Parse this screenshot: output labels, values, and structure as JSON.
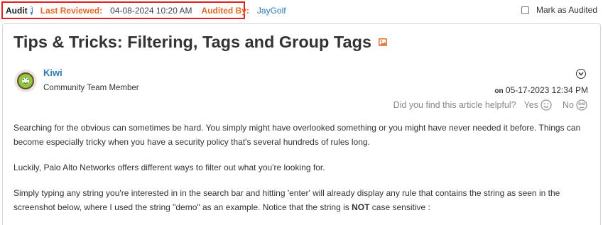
{
  "audit": {
    "label": "Audit",
    "last_reviewed_label": "Last Reviewed:",
    "last_reviewed_value": "04-08-2024 10:20 AM",
    "audited_by_label": "Audited By:",
    "audited_by_value": "JayGolf",
    "mark_label": "Mark as Audited",
    "info_icon_text": "i"
  },
  "article": {
    "title": "Tips & Tricks: Filtering, Tags and Group Tags",
    "author": {
      "name": "Kiwi",
      "role": "Community Team Member"
    },
    "date_prefix": "on",
    "date": "05-17-2023 12:34 PM",
    "helpful": {
      "question": "Did you find this article helpful?",
      "yes_label": "Yes",
      "no_label": "No"
    },
    "paragraphs": {
      "p1": "Searching for the obvious can sometimes be hard. You simply might have overlooked something or you might have never needed it before. Things can become especially tricky when you have a security policy that's several hundreds of rules long.",
      "p2": "Luckily, Palo Alto Networks offers different ways to filter out what you're looking for.",
      "p3a": "Simply typing any string you're interested in in the search bar and hitting 'enter' will already display any rule that contains the string as seen in the screenshot below, where I used the string \"demo\" as an example. Notice that the string is ",
      "p3b": "NOT",
      "p3c": " case sensitive :"
    }
  },
  "colors": {
    "audit_border": "#e02020",
    "label_orange": "#e06b2a",
    "link_blue": "#2a7ab8"
  },
  "icons": [
    "info-icon",
    "image-icon",
    "avatar-kiwi",
    "chevron-down-icon",
    "smiley-icon",
    "frown-icon"
  ]
}
